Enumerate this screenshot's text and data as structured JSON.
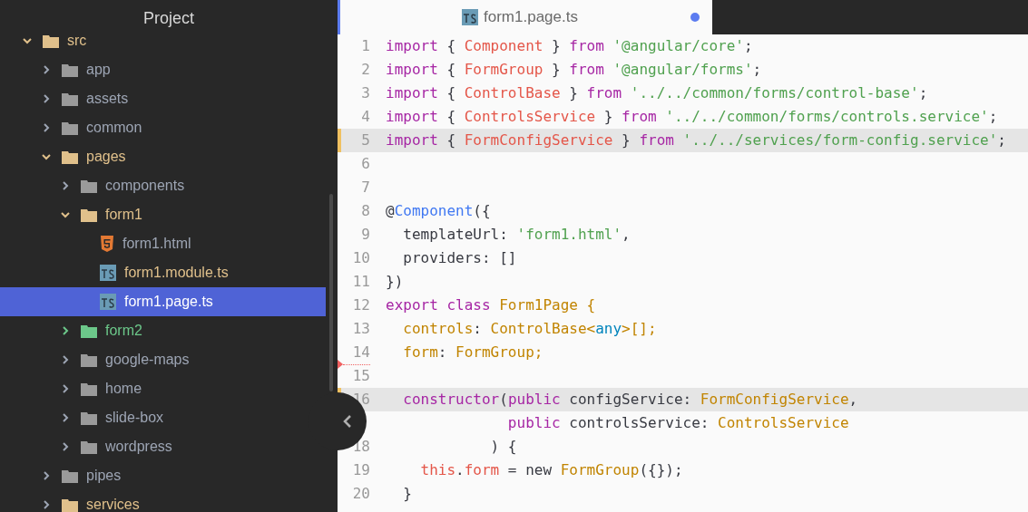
{
  "sidebar": {
    "title": "Project",
    "tree": [
      {
        "label": "src",
        "kind": "folder",
        "color": "#e0c08b",
        "expanded": true,
        "selected": false,
        "children": [
          {
            "label": "app",
            "kind": "folder",
            "color": "#9da5b4",
            "expanded": false,
            "selected": false
          },
          {
            "label": "assets",
            "kind": "folder",
            "color": "#9da5b4",
            "expanded": false,
            "selected": false
          },
          {
            "label": "common",
            "kind": "folder",
            "color": "#9da5b4",
            "expanded": false,
            "selected": false
          },
          {
            "label": "pages",
            "kind": "folder",
            "color": "#e0c08b",
            "expanded": true,
            "selected": false,
            "children": [
              {
                "label": "components",
                "kind": "folder",
                "color": "#9da5b4",
                "expanded": false,
                "selected": false
              },
              {
                "label": "form1",
                "kind": "folder",
                "color": "#e0c08b",
                "expanded": true,
                "selected": false,
                "children": [
                  {
                    "label": "form1.html",
                    "kind": "html",
                    "color": "#9da5b4",
                    "selected": false
                  },
                  {
                    "label": "form1.module.ts",
                    "kind": "ts",
                    "color": "#e0c08b",
                    "selected": false
                  },
                  {
                    "label": "form1.page.ts",
                    "kind": "ts",
                    "selected": true
                  }
                ]
              },
              {
                "label": "form2",
                "kind": "folder",
                "color": "#6cc88a",
                "expanded": false,
                "selected": false
              },
              {
                "label": "google-maps",
                "kind": "folder",
                "color": "#9da5b4",
                "expanded": false,
                "selected": false
              },
              {
                "label": "home",
                "kind": "folder",
                "color": "#9da5b4",
                "expanded": false,
                "selected": false
              },
              {
                "label": "slide-box",
                "kind": "folder",
                "color": "#9da5b4",
                "expanded": false,
                "selected": false
              },
              {
                "label": "wordpress",
                "kind": "folder",
                "color": "#9da5b4",
                "expanded": false,
                "selected": false
              }
            ]
          },
          {
            "label": "pipes",
            "kind": "folder",
            "color": "#9da5b4",
            "expanded": false,
            "selected": false
          },
          {
            "label": "services",
            "kind": "folder",
            "color": "#e0c08b",
            "expanded": false,
            "selected": false
          }
        ]
      }
    ]
  },
  "editor": {
    "tab": {
      "label": "form1.page.ts",
      "modified": true
    },
    "lines": [
      {
        "number": "1",
        "highlighted": false,
        "modified": false,
        "deleted": false,
        "tokens": [
          {
            "t": "import",
            "kind": "keyword"
          },
          {
            "t": " { ",
            "kind": "plain"
          },
          {
            "t": "Component",
            "kind": "name"
          },
          {
            "t": " } ",
            "kind": "plain"
          },
          {
            "t": "from",
            "kind": "keyword"
          },
          {
            "t": " '@angular/core'",
            "kind": "string"
          },
          {
            "t": ";",
            "kind": "plain"
          }
        ]
      },
      {
        "number": "2",
        "highlighted": false,
        "modified": false,
        "deleted": false,
        "tokens": [
          {
            "t": "import",
            "kind": "keyword"
          },
          {
            "t": " { ",
            "kind": "plain"
          },
          {
            "t": "FormGroup",
            "kind": "name"
          },
          {
            "t": " } ",
            "kind": "plain"
          },
          {
            "t": "from",
            "kind": "keyword"
          },
          {
            "t": " '@angular/forms'",
            "kind": "string"
          },
          {
            "t": ";",
            "kind": "plain"
          }
        ]
      },
      {
        "number": "3",
        "highlighted": false,
        "modified": false,
        "deleted": false,
        "tokens": [
          {
            "t": "import",
            "kind": "keyword"
          },
          {
            "t": " { ",
            "kind": "plain"
          },
          {
            "t": "ControlBase",
            "kind": "name"
          },
          {
            "t": " } ",
            "kind": "plain"
          },
          {
            "t": "from",
            "kind": "keyword"
          },
          {
            "t": " '../../common/forms/control-base'",
            "kind": "string"
          },
          {
            "t": ";",
            "kind": "plain"
          }
        ]
      },
      {
        "number": "4",
        "highlighted": false,
        "modified": false,
        "deleted": false,
        "tokens": [
          {
            "t": "import",
            "kind": "keyword"
          },
          {
            "t": " { ",
            "kind": "plain"
          },
          {
            "t": "ControlsService",
            "kind": "name"
          },
          {
            "t": " } ",
            "kind": "plain"
          },
          {
            "t": "from",
            "kind": "keyword"
          },
          {
            "t": " '../../common/forms/controls.service'",
            "kind": "string"
          },
          {
            "t": ";",
            "kind": "plain"
          }
        ]
      },
      {
        "number": "5",
        "highlighted": true,
        "modified": true,
        "deleted": false,
        "tokens": [
          {
            "t": "import",
            "kind": "keyword"
          },
          {
            "t": " { ",
            "kind": "plain"
          },
          {
            "t": "FormConfigService",
            "kind": "name"
          },
          {
            "t": " } ",
            "kind": "plain"
          },
          {
            "t": "from",
            "kind": "keyword"
          },
          {
            "t": " '../../services/form-config.service'",
            "kind": "string"
          },
          {
            "t": ";",
            "kind": "plain"
          }
        ]
      },
      {
        "number": "6",
        "highlighted": false,
        "modified": false,
        "deleted": false
      },
      {
        "number": "7",
        "highlighted": false,
        "modified": false,
        "deleted": false
      },
      {
        "number": "8",
        "highlighted": false,
        "modified": false,
        "deleted": false,
        "tokens": [
          {
            "t": "@",
            "kind": "plain"
          },
          {
            "t": "Component",
            "kind": "decorator"
          },
          {
            "t": "({",
            "kind": "plain"
          }
        ]
      },
      {
        "number": "9",
        "highlighted": false,
        "modified": false,
        "deleted": false,
        "tokens": [
          {
            "t": "  templateUrl: ",
            "kind": "plain"
          },
          {
            "t": "'form1.html'",
            "kind": "string"
          },
          {
            "t": ",",
            "kind": "plain"
          }
        ]
      },
      {
        "number": "10",
        "highlighted": false,
        "modified": false,
        "deleted": false,
        "tokens": [
          {
            "t": "  providers: []",
            "kind": "plain"
          }
        ]
      },
      {
        "number": "11",
        "highlighted": false,
        "modified": false,
        "deleted": false,
        "tokens": [
          {
            "t": "})",
            "kind": "plain"
          }
        ]
      },
      {
        "number": "12",
        "highlighted": false,
        "modified": false,
        "deleted": false,
        "tokens": [
          {
            "t": "export class",
            "kind": "keyword"
          },
          {
            "t": " Form1Page {",
            "kind": "type"
          }
        ]
      },
      {
        "number": "13",
        "highlighted": false,
        "modified": false,
        "deleted": false,
        "tokens": [
          {
            "t": "  controls",
            "kind": "type"
          },
          {
            "t": ": ",
            "kind": "plain"
          },
          {
            "t": "ControlBase<",
            "kind": "type"
          },
          {
            "t": "any",
            "kind": "builtin"
          },
          {
            "t": ">[];",
            "kind": "type"
          }
        ]
      },
      {
        "number": "14",
        "highlighted": false,
        "modified": false,
        "deleted": true,
        "tokens": [
          {
            "t": "  form",
            "kind": "type"
          },
          {
            "t": ": ",
            "kind": "plain"
          },
          {
            "t": "FormGroup;",
            "kind": "type"
          }
        ]
      },
      {
        "number": "15",
        "highlighted": false,
        "modified": false,
        "deleted": false
      },
      {
        "number": "16",
        "highlighted": true,
        "modified": true,
        "deleted": false,
        "tokens": [
          {
            "t": "  constructor",
            "kind": "keyword"
          },
          {
            "t": "(",
            "kind": "plain"
          },
          {
            "t": "public",
            "kind": "keyword"
          },
          {
            "t": " configService: ",
            "kind": "plain"
          },
          {
            "t": "FormConfigService",
            "kind": "type"
          },
          {
            "t": ",",
            "kind": "plain"
          }
        ]
      },
      {
        "highlighted": false,
        "modified": false,
        "deleted": false,
        "tokens": [
          {
            "t": "              public",
            "kind": "keyword"
          },
          {
            "t": " controlsService: ",
            "kind": "plain"
          },
          {
            "t": "ControlsService",
            "kind": "type"
          }
        ]
      },
      {
        "number": "18",
        "highlighted": false,
        "modified": false,
        "deleted": false,
        "tokens": [
          {
            "t": "            ) {",
            "kind": "plain"
          }
        ]
      },
      {
        "number": "19",
        "highlighted": false,
        "modified": false,
        "deleted": false,
        "tokens": [
          {
            "t": "    this",
            "kind": "name"
          },
          {
            "t": ".",
            "kind": "plain"
          },
          {
            "t": "form",
            "kind": "name"
          },
          {
            "t": " = new ",
            "kind": "plain"
          },
          {
            "t": "FormGroup",
            "kind": "type"
          },
          {
            "t": "({});",
            "kind": "plain"
          }
        ]
      },
      {
        "number": "20",
        "highlighted": false,
        "modified": false,
        "deleted": false,
        "tokens": [
          {
            "t": "  }",
            "kind": "plain"
          }
        ]
      }
    ]
  }
}
